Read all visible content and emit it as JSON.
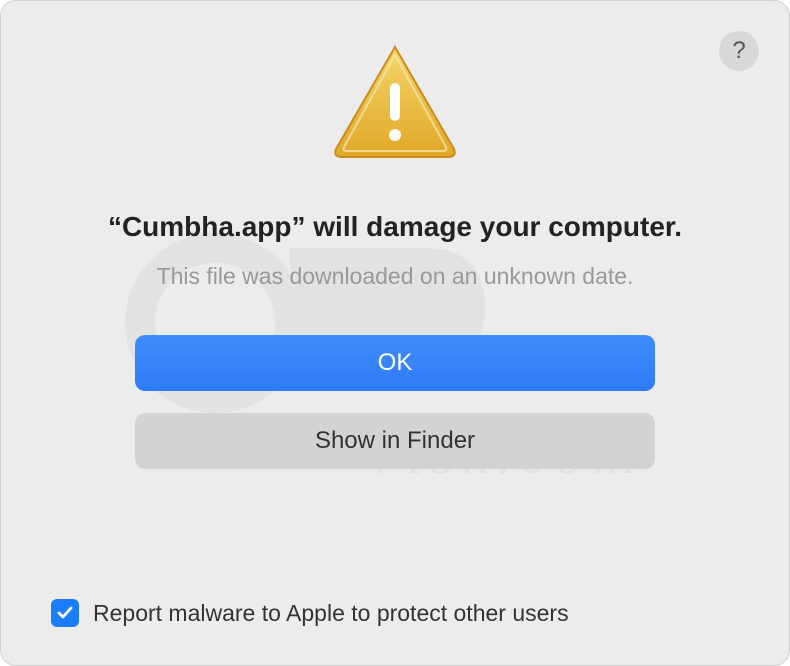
{
  "dialog": {
    "title": "“Cumbha.app” will damage your computer.",
    "subtitle": "This file was downloaded on an unknown date.",
    "primary_button": "OK",
    "secondary_button": "Show in Finder",
    "checkbox_label": "Report malware to Apple to protect other users",
    "checkbox_checked": true,
    "help_icon": "?"
  }
}
